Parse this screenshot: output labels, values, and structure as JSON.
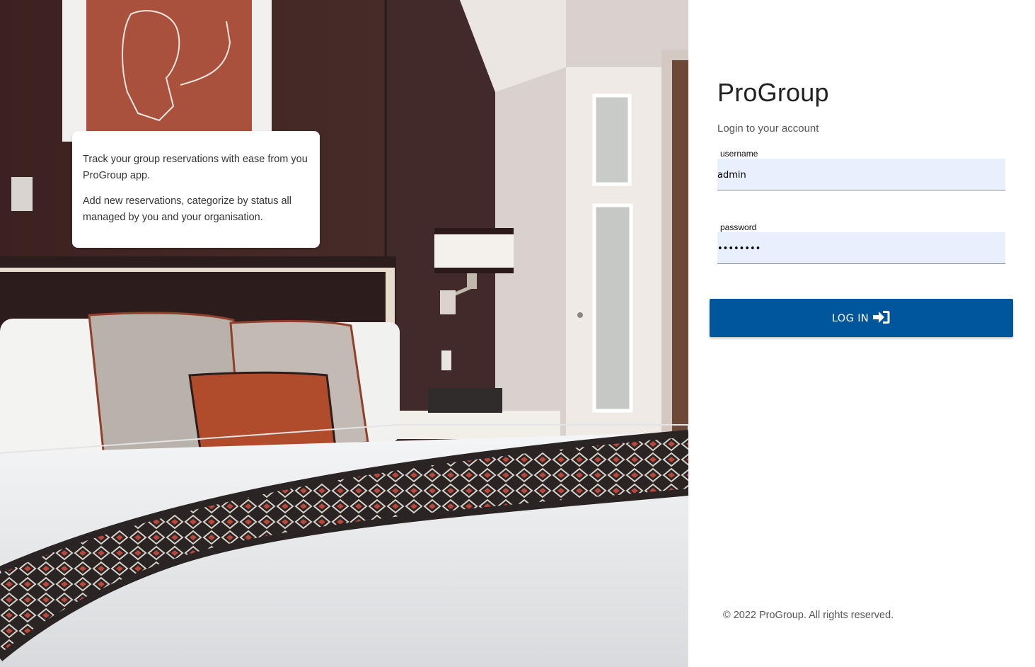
{
  "hero": {
    "paragraphs": [
      "Track your group reservations with ease from you ProGroup app.",
      "Add new reservations, categorize by status all managed by you and your organisation."
    ]
  },
  "login": {
    "brand": "ProGroup",
    "subtitle": "Login to your account",
    "username_label": "username",
    "username_value": "admin",
    "password_label": "password",
    "password_value": "password",
    "button_label": "LOG IN",
    "button_icon": "sign-in-icon"
  },
  "footer": {
    "copyright": "© 2022 ProGroup. All rights reserved."
  },
  "colors": {
    "accent": "#00569b",
    "input_bg": "#e8f0fe"
  }
}
